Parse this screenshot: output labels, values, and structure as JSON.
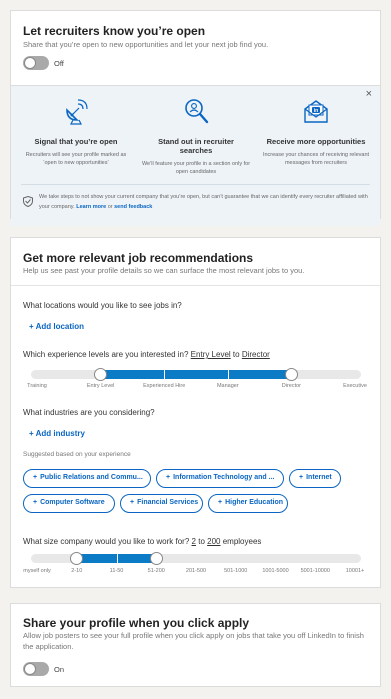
{
  "open_card": {
    "title": "Let recruiters know you’re open",
    "subtitle": "Share that you’re open to new opportunities and let your next job find you.",
    "toggle_label": "Off",
    "close_glyph": "×",
    "features": [
      {
        "icon": "satellite-dish-icon",
        "title": "Signal that you’re open",
        "desc": "Recruiters will see your profile marked as ‘open to new opportunities’"
      },
      {
        "icon": "magnifier-person-icon",
        "title": "Stand out in recruiter searches",
        "desc": "We’ll feature your profile in a section only for open candidates"
      },
      {
        "icon": "inmail-envelope-icon",
        "title": "Receive more opportunities",
        "desc": "Increase your chances of receiving relevant messages from recruiters"
      }
    ],
    "privacy_text": "We take steps to not show your current company that you’re open, but can’t guarantee that we can identify every recruiter affiliated with your company.",
    "learn_more": "Learn more",
    "or": "or",
    "send_feedback": "send feedback"
  },
  "rec_card": {
    "title": "Get more relevant job recommendations",
    "subtitle": "Help us see past your profile details so we can surface the most relevant jobs to you.",
    "locations_q": "What locations would you like to see jobs in?",
    "add_location": "+ Add location",
    "experience_q_prefix": "Which experience levels are you interested in?",
    "experience_from": "Entry Level",
    "experience_to_word": "to",
    "experience_to": "Director",
    "experience_levels": [
      "Training",
      "Entry Level",
      "Experienced Hire",
      "Manager",
      "Director",
      "Executive"
    ],
    "experience_range": [
      1,
      4
    ],
    "industries_q": "What industries are you considering?",
    "add_industry": "+ Add industry",
    "suggested_label": "Suggested based on your experience",
    "suggested": [
      "Public Relations and Commu...",
      "Information Technology and ...",
      "Internet",
      "Computer Software",
      "Financial Services",
      "Higher Education"
    ],
    "size_q_prefix": "What size company would you like to work for?",
    "size_from": "2",
    "size_to_word": "to",
    "size_to": "200",
    "size_suffix": "employees",
    "size_levels": [
      "myself only",
      "2-10",
      "11-50",
      "51-200",
      "201-500",
      "501-1000",
      "1001-5000",
      "5001-10000",
      "10001+"
    ],
    "size_range": [
      1,
      3
    ]
  },
  "share_card": {
    "title": "Share your profile when you click apply",
    "subtitle": "Allow job posters to see your full profile when you click apply on jobs that take you off LinkedIn to finish the application.",
    "toggle_label": "On"
  },
  "colors": {
    "accent": "#0a66c2",
    "slider_fill": "#0a7bc4",
    "promo_bg": "#eef3f8"
  }
}
